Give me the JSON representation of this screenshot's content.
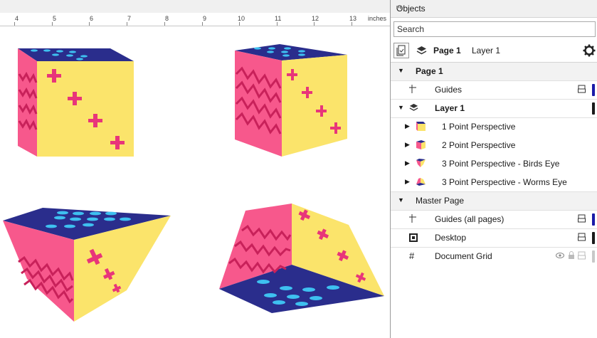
{
  "ruler": {
    "numbers": [
      "4",
      "5",
      "6",
      "7",
      "8",
      "9",
      "10",
      "11",
      "12",
      "13"
    ],
    "unit": "inches"
  },
  "panel": {
    "title": "Objects",
    "collapse_icon": "double-chevron-right-icon",
    "search_placeholder": "Search",
    "toolbar": {
      "page_label": "Page 1",
      "layer_label": "Layer 1"
    },
    "tree": {
      "page1": "Page 1",
      "guides": "Guides",
      "layer1": "Layer 1",
      "items": [
        "1 Point Perspective",
        "2 Point Perspective",
        "3 Point Perspective - Birds Eye",
        "3 Point Perspective - Worms Eye"
      ],
      "master": "Master Page",
      "guides_all": "Guides (all pages)",
      "desktop": "Desktop",
      "document_grid": "Document Grid"
    },
    "colors": {
      "guides_bar": "#1a1aa8",
      "layer_bar": "#1a1a1a",
      "guides_all_bar": "#1a1aa8",
      "desktop_bar": "#1a1a1a",
      "grid_bar": "#c8c8c8"
    }
  },
  "colors": {
    "navy": "#2a2d8c",
    "yellow": "#fbe46b",
    "pink": "#f7588c",
    "magenta": "#e8357a",
    "dots": "#3ec0f0",
    "zigzag": "#c8215a"
  }
}
